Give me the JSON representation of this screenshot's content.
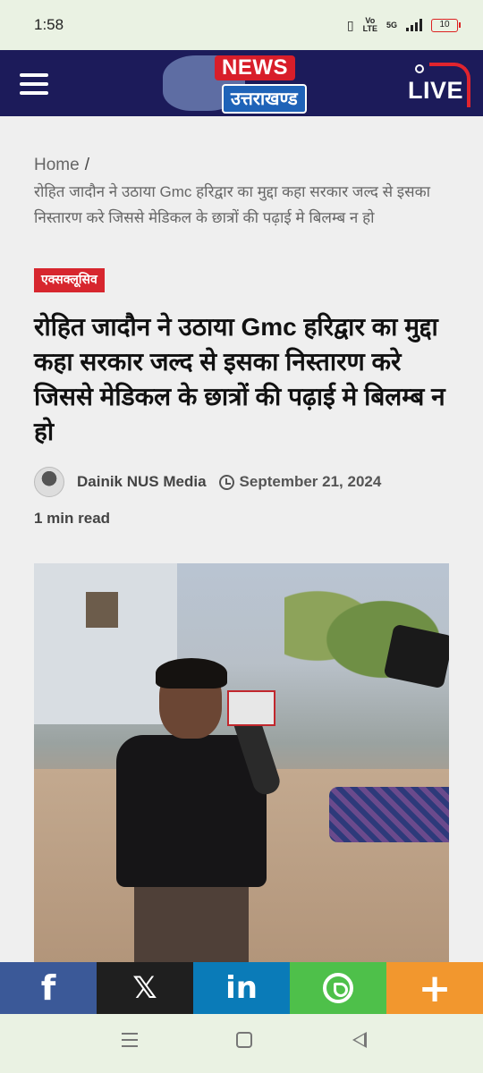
{
  "status_bar": {
    "time": "1:58",
    "network_label_top": "Vo",
    "network_label_bottom": "LTE",
    "network_type": "5G",
    "battery_level": "10"
  },
  "header": {
    "logo_top": "NEWS",
    "logo_bottom": "उत्तराखण्ड",
    "live_label": "LIVE",
    "colors": {
      "background": "#1c1b5a",
      "news_red": "#d81e2a",
      "logo_blue": "#1f63b8"
    }
  },
  "breadcrumb": {
    "home": "Home",
    "separator": "/",
    "current": "रोहित जादौन ने उठाया Gmc हरिद्वार का मुद्दा कहा सरकार जल्द से इसका निस्तारण करे जिससे मेडिकल के छात्रों की पढ़ाई मे बिलम्ब न हो"
  },
  "article": {
    "category": "एक्सक्लूसिव",
    "title": "रोहित जादौन ने उठाया Gmc हरिद्वार का मुद्दा कहा सरकार जल्द से इसका निस्तारण करे जिससे मेडिकल के छात्रों की पढ़ाई मे बिलम्ब न हो",
    "author": "Dainik NUS Media",
    "date": "September 21, 2024",
    "read_time": "1 min read"
  },
  "share_bar": {
    "facebook": "f",
    "x": "𝕏",
    "linkedin": "in",
    "whatsapp": "whatsapp-icon",
    "more": "+"
  },
  "icons": {
    "menu": "hamburger-icon",
    "clock": "clock-icon",
    "nav_recent": "recent-apps-icon",
    "nav_home": "home-icon",
    "nav_back": "back-icon"
  }
}
